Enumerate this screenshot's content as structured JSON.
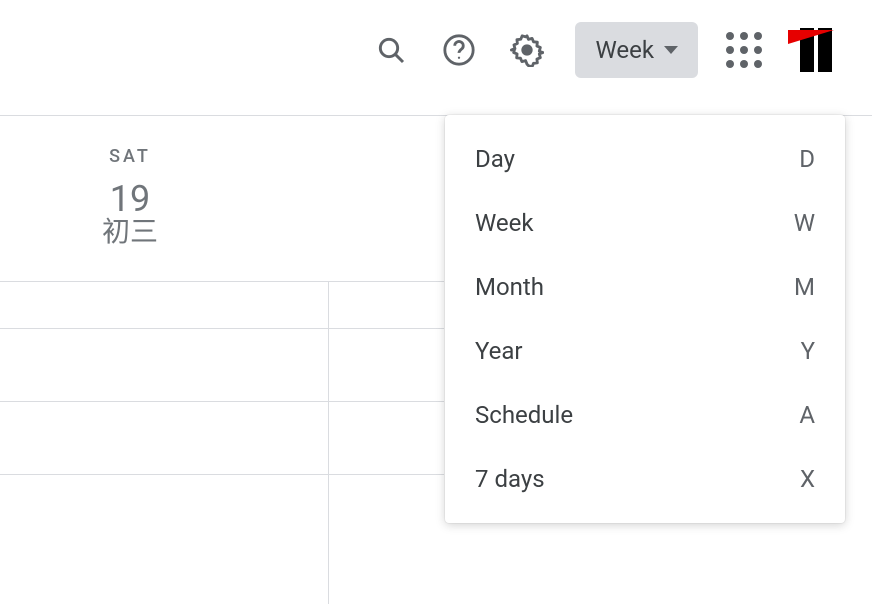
{
  "toolbar": {
    "view_selector_label": "Week"
  },
  "day_header": {
    "label": "SAT",
    "number": "19",
    "sub": "初三"
  },
  "dropdown": {
    "items": [
      {
        "label": "Day",
        "shortcut": "D"
      },
      {
        "label": "Week",
        "shortcut": "W"
      },
      {
        "label": "Month",
        "shortcut": "M"
      },
      {
        "label": "Year",
        "shortcut": "Y"
      },
      {
        "label": "Schedule",
        "shortcut": "A"
      },
      {
        "label": "7 days",
        "shortcut": "X"
      }
    ]
  }
}
